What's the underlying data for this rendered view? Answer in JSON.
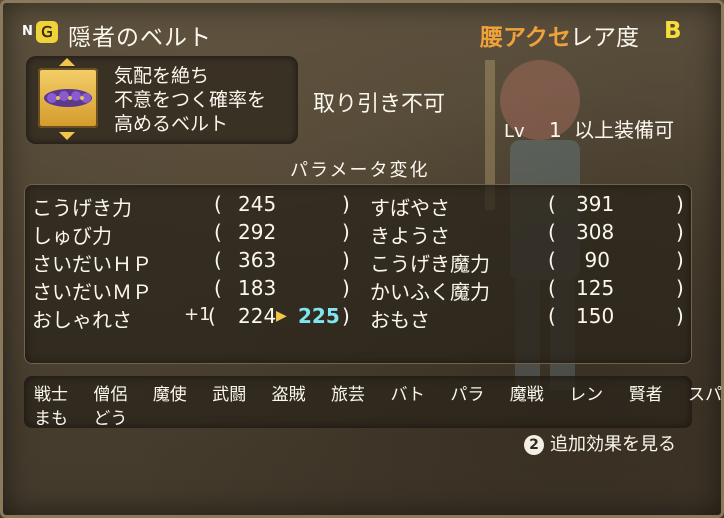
{
  "header": {
    "n_mark": "N",
    "belt_tag_glyph": "Ｇ",
    "item_name": "隠者のベルト",
    "category": "腰アクセ",
    "rarity_label": "レア度",
    "rarity_value": "B"
  },
  "description": {
    "lines": [
      "気配を絶ち",
      "不意をつく確率を",
      "高めるベルト"
    ]
  },
  "trade_status": "取り引き不可",
  "equip_requirement": {
    "lv_label": "Lv",
    "level": "1",
    "text": "以上装備可"
  },
  "params_title": "パラメータ変化",
  "stats": {
    "left": [
      {
        "name": "こうげき力",
        "value": "245"
      },
      {
        "name": "しゅび力",
        "value": "292"
      },
      {
        "name": "さいだいＨＰ",
        "value": "363"
      },
      {
        "name": "さいだいＭＰ",
        "value": "183"
      },
      {
        "name": "おしゃれさ",
        "bonus": "+1",
        "value": "224",
        "new_value": "225"
      }
    ],
    "right": [
      {
        "name": "すばやさ",
        "value": "391"
      },
      {
        "name": "きようさ",
        "value": "308"
      },
      {
        "name": "こうげき魔力",
        "value": "90"
      },
      {
        "name": "かいふく魔力",
        "value": "125"
      },
      {
        "name": "おもさ",
        "value": "150"
      }
    ],
    "paren_open": "(",
    "paren_close": ")"
  },
  "jobs": {
    "row1": [
      "戦士",
      "僧侶",
      "魔使",
      "武闘",
      "盗賊",
      "旅芸",
      "バト",
      "パラ",
      "魔戦",
      "レン",
      "賢者",
      "スパ"
    ],
    "row2": [
      "まも",
      "どう"
    ]
  },
  "more_effects": {
    "button_glyph": "2",
    "label": "追加効果を見る"
  },
  "colors": {
    "category": "#f0a23a",
    "rarity": "#f7df3a",
    "increase": "#7fe6f0"
  }
}
